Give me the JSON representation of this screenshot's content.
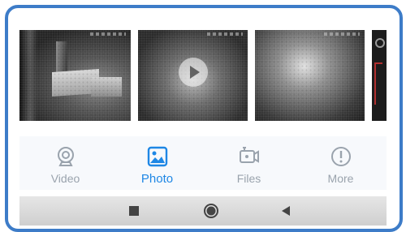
{
  "gallery": {
    "thumbnails": [
      {
        "kind": "photo"
      },
      {
        "kind": "video",
        "overlay_icon": "play-icon"
      },
      {
        "kind": "photo"
      },
      {
        "kind": "photo"
      }
    ]
  },
  "tabs": [
    {
      "id": "video",
      "label": "Video",
      "icon": "camera-icon",
      "active": false
    },
    {
      "id": "photo",
      "label": "Photo",
      "icon": "image-icon",
      "active": true
    },
    {
      "id": "files",
      "label": "Files",
      "icon": "video-file-icon",
      "active": false
    },
    {
      "id": "more",
      "label": "More",
      "icon": "info-icon",
      "active": false
    }
  ],
  "navigation": {
    "buttons": [
      "recents-square-icon",
      "home-circle-icon",
      "back-triangle-icon"
    ]
  },
  "colors": {
    "frame_border": "#3d7cc8",
    "active_tab": "#1e87e5",
    "inactive_tab": "#9aa3ad"
  }
}
